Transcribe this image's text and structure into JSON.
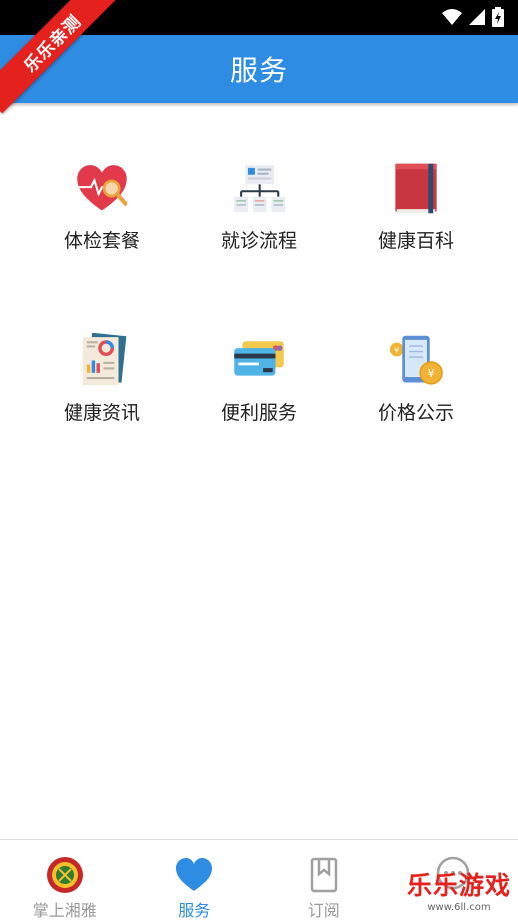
{
  "header": {
    "title": "服务"
  },
  "watermark": {
    "ribbon_text": "乐乐亲测",
    "corner_title": "乐乐游戏",
    "corner_url": "www.6ll.com"
  },
  "services": [
    {
      "label": "体检套餐",
      "icon": "heart-checkup-icon"
    },
    {
      "label": "就诊流程",
      "icon": "flowchart-icon"
    },
    {
      "label": "健康百科",
      "icon": "book-icon"
    },
    {
      "label": "健康资讯",
      "icon": "report-icon"
    },
    {
      "label": "便利服务",
      "icon": "bank-card-icon"
    },
    {
      "label": "价格公示",
      "icon": "phone-price-icon"
    }
  ],
  "bottom_nav": [
    {
      "label": "掌上湘雅",
      "icon": "hospital-emblem-icon",
      "active": false
    },
    {
      "label": "服务",
      "icon": "heart-icon",
      "active": true
    },
    {
      "label": "订阅",
      "icon": "bookmark-icon",
      "active": false
    },
    {
      "label": "",
      "icon": "chat-icon",
      "active": false
    }
  ],
  "colors": {
    "primary": "#2e8ce3",
    "status_bar": "#000000",
    "ribbon": "#e5211d"
  }
}
